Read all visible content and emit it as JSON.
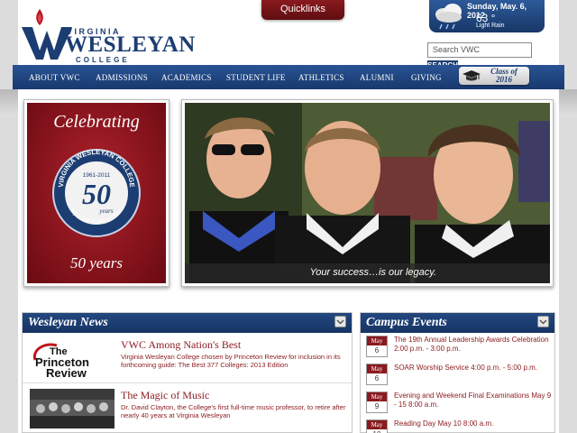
{
  "header": {
    "logo_top": "VIRGINIA",
    "logo_main": "WESLEYAN",
    "logo_bottom": "COLLEGE",
    "quicklinks_label": "Quicklinks"
  },
  "weather": {
    "date": "Sunday, May. 6, 2012",
    "temp": "63 °",
    "condition": "Light Rain",
    "icon": "rain-cloud-icon"
  },
  "search": {
    "placeholder": "Search VWC",
    "button_label": "SEARCH"
  },
  "nav": {
    "items": [
      {
        "label": "ABOUT VWC"
      },
      {
        "label": "ADMISSIONS"
      },
      {
        "label": "ACADEMICS"
      },
      {
        "label": "STUDENT LIFE"
      },
      {
        "label": "ATHLETICS"
      },
      {
        "label": "ALUMNI"
      },
      {
        "label": "GIVING"
      }
    ],
    "class_badge_line1": "Class of",
    "class_badge_line2": "2016"
  },
  "hero": {
    "celebrate_title": "Celebrating",
    "celebrate_years": "50 years",
    "seal_text_top": "VIRGINIA WESLEYAN COLLEGE",
    "seal_dates": "1961-2011",
    "seal_number": "50",
    "seal_sub": "years",
    "seal_motto": "Sapientia Illuminat Viam",
    "photo_caption": "Your success…is our legacy."
  },
  "news": {
    "heading": "Wesleyan News",
    "items": [
      {
        "title": "VWC Among Nation's Best",
        "desc": "Virginia Wesleyan College chosen by Princeton Review for inclusion in its forthcoming guide: The Best 377 Colleges: 2013 Edition",
        "thumb_text": "The Princeton Review"
      },
      {
        "title": "The Magic of Music",
        "desc": "Dr. David Clayton, the College's first full-time music professor, to retire after nearly 40 years at Virginia Wesleyan"
      }
    ]
  },
  "events": {
    "heading": "Campus Events",
    "items": [
      {
        "month": "May",
        "day": "6",
        "text": "The 19th Annual Leadership Awards Celebration 2:00 p.m. - 3:00 p.m."
      },
      {
        "month": "May",
        "day": "6",
        "text": "SOAR Worship Service 4:00 p.m. - 5:00 p.m."
      },
      {
        "month": "May",
        "day": "9",
        "text": "Evening and Weekend Final Examinations May 9 - 15 8:00 a.m."
      },
      {
        "month": "May",
        "day": "10",
        "text": "Reading Day May 10 8:00 a.m."
      }
    ]
  },
  "colors": {
    "navy": "#1c3d72",
    "maroon": "#8a1a1f"
  }
}
